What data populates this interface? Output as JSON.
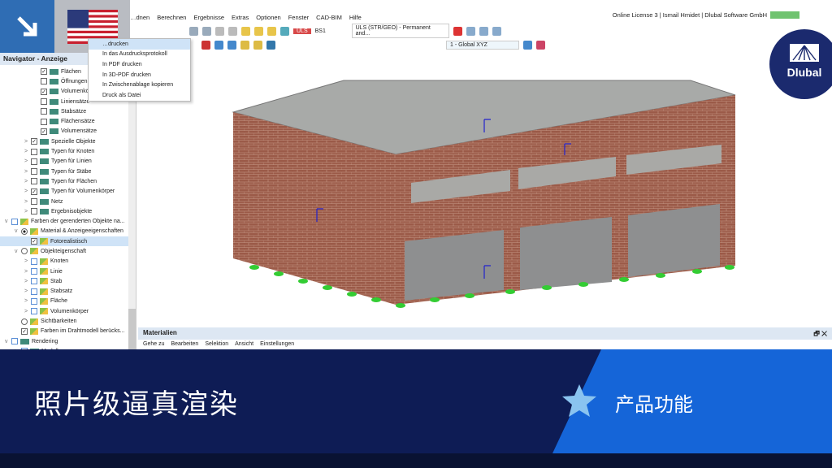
{
  "menubar": [
    "…dnen",
    "Berechnen",
    "Ergebnisse",
    "Extras",
    "Optionen",
    "Fenster",
    "CAD-BIM",
    "Hilfe"
  ],
  "license": "Online License 3 | Ismail Hmidet | Dlubal Software GmbH",
  "toolbar": {
    "uls_badge": "ULS",
    "bs": "BS1",
    "combo": "ULS (STR/GEO) - Permanent and...",
    "coord_system": "1 - Global XYZ"
  },
  "navigator": {
    "title": "Navigator - Anzeige",
    "items": [
      {
        "label": "Flächen",
        "level": 3,
        "check": "on",
        "icon": "tag"
      },
      {
        "label": "Öffnungen",
        "level": 3,
        "check": "off",
        "icon": "tag"
      },
      {
        "label": "Volumenkörper",
        "level": 3,
        "check": "on",
        "icon": "tag"
      },
      {
        "label": "Liniensätze",
        "level": 3,
        "check": "off",
        "icon": "tag"
      },
      {
        "label": "Stabsätze",
        "level": 3,
        "check": "off",
        "icon": "tag"
      },
      {
        "label": "Flächensätze",
        "level": 3,
        "check": "off",
        "icon": "tag"
      },
      {
        "label": "Volumensätze",
        "level": 3,
        "check": "on",
        "icon": "tag"
      },
      {
        "label": "Spezielle Objekte",
        "level": 2,
        "check": "on",
        "icon": "tag",
        "chev": ">"
      },
      {
        "label": "Typen für Knoten",
        "level": 2,
        "check": "off",
        "icon": "tag",
        "chev": ">"
      },
      {
        "label": "Typen für Linien",
        "level": 2,
        "check": "off",
        "icon": "tag",
        "chev": ">"
      },
      {
        "label": "Typen für Stäbe",
        "level": 2,
        "check": "off",
        "icon": "tag",
        "chev": ">"
      },
      {
        "label": "Typen für Flächen",
        "level": 2,
        "check": "off",
        "icon": "tag",
        "chev": ">"
      },
      {
        "label": "Typen für Volumenkörper",
        "level": 2,
        "check": "on",
        "icon": "tag",
        "chev": ">"
      },
      {
        "label": "Netz",
        "level": 2,
        "check": "off",
        "icon": "tag",
        "chev": ">"
      },
      {
        "label": "Ergebnisobjekte",
        "level": 2,
        "check": "off",
        "icon": "tag",
        "chev": ">"
      },
      {
        "label": "Farben der gerenderten Objekte na...",
        "level": 0,
        "check": "blue",
        "icon": "pen",
        "chev": "v"
      },
      {
        "label": "Material & Anzeigeeigenschaften",
        "level": 1,
        "check": "radio-on",
        "icon": "pen",
        "chev": "v"
      },
      {
        "label": "Fotorealistisch",
        "level": 2,
        "check": "on",
        "icon": "pen",
        "selected": true
      },
      {
        "label": "Objekteigenschaft",
        "level": 1,
        "check": "radio-off",
        "icon": "pen",
        "chev": "v"
      },
      {
        "label": "Knoten",
        "level": 2,
        "check": "blue",
        "icon": "pen",
        "chev": ">"
      },
      {
        "label": "Linie",
        "level": 2,
        "check": "blue",
        "icon": "pen",
        "chev": ">"
      },
      {
        "label": "Stab",
        "level": 2,
        "check": "blue",
        "icon": "pen",
        "chev": ">"
      },
      {
        "label": "Stabsatz",
        "level": 2,
        "check": "blue",
        "icon": "pen",
        "chev": ">"
      },
      {
        "label": "Fläche",
        "level": 2,
        "check": "blue",
        "icon": "pen",
        "chev": ">"
      },
      {
        "label": "Volumenkörper",
        "level": 2,
        "check": "blue",
        "icon": "pen",
        "chev": ">"
      },
      {
        "label": "Sichtbarkeiten",
        "level": 1,
        "check": "radio-off",
        "icon": "pen"
      },
      {
        "label": "Farben im Drahtmodell berücks...",
        "level": 1,
        "check": "on",
        "icon": "pen"
      },
      {
        "label": "Rendering",
        "level": 0,
        "check": "blue",
        "icon": "tag",
        "chev": "v"
      },
      {
        "label": "Modell",
        "level": 1,
        "check": "blue",
        "icon": "tag",
        "chev": ">"
      }
    ]
  },
  "print_menu": [
    "…drucken",
    "In das Ausdrucksprotokoll",
    "In PDF drucken",
    "In 3D-PDF drucken",
    "In Zwischenablage kopieren",
    "Druck als Datei"
  ],
  "panel": {
    "title": "Materialien",
    "menu": [
      "Gehe zu",
      "Bearbeiten",
      "Selektion",
      "Ansicht",
      "Einstellungen"
    ],
    "restore": "🗗",
    "close": "✕"
  },
  "banner": {
    "title": "照片级逼真渲染",
    "feature": "产品功能"
  },
  "logo": "Dlubal",
  "colors": {
    "brand_navy": "#0e1c55",
    "accent_blue": "#1565d8",
    "brick": "#9b5a48"
  }
}
